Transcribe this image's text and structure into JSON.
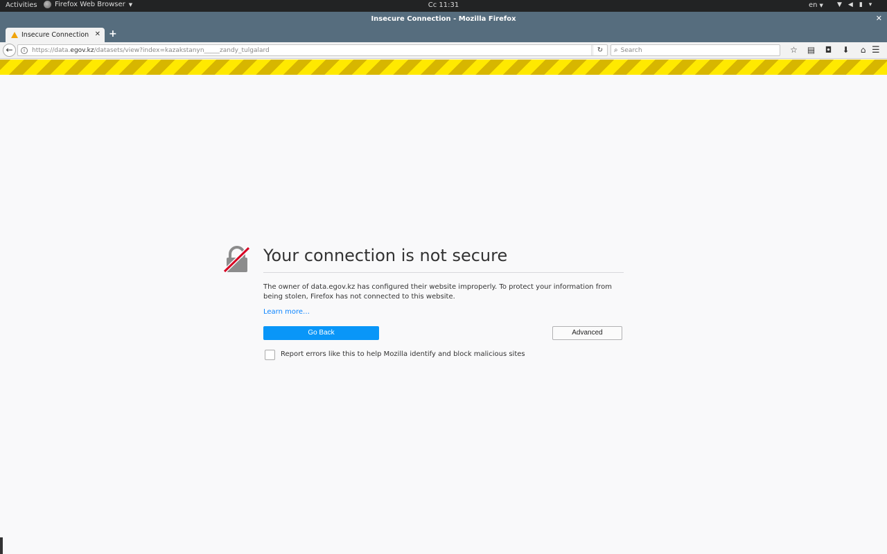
{
  "topbar": {
    "activities": "Activities",
    "app_menu": "Firefox Web Browser",
    "clock": "Cc 11:31",
    "language": "en"
  },
  "window": {
    "title": "Insecure Connection - Mozilla Firefox"
  },
  "tabs": [
    {
      "label": "Insecure Connection",
      "icon": "warning-icon",
      "active": true
    }
  ],
  "navbar": {
    "url_scheme": "https://data.",
    "url_host": "egov.kz",
    "url_path": "/datasets/view?index=kazakstanyn_____zandy_tulgalard",
    "search_placeholder": "Search"
  },
  "error_page": {
    "title": "Your connection is not secure",
    "description": "The owner of data.egov.kz has configured their website improperly. To protect your information from being stolen, Firefox has not connected to this website.",
    "learn_more": "Learn more…",
    "go_back": "Go Back",
    "advanced": "Advanced",
    "report_label": "Report errors like this to help Mozilla identify and block malicious sites"
  },
  "colors": {
    "accent": "#0996f8",
    "warning_stripe": "#ffe900",
    "titlebar": "#566d7e"
  }
}
